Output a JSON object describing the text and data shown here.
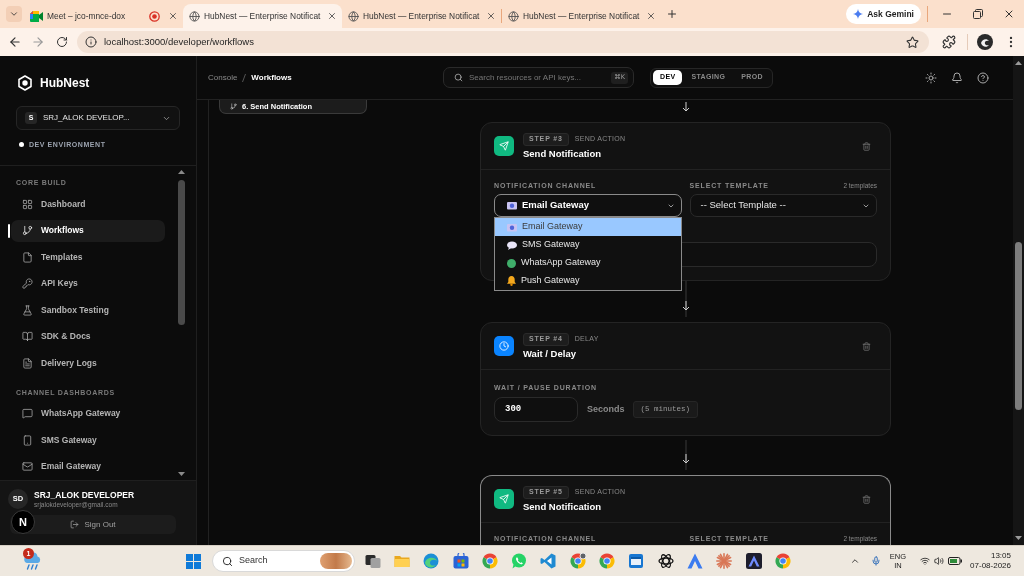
{
  "browser": {
    "tabs": [
      {
        "kind": "meet",
        "title": "Meet – jco-mnce-dox",
        "recording": true,
        "selected": false
      },
      {
        "kind": "page",
        "title": "HubNest — Enterprise Notificat",
        "recording": false,
        "selected": true
      },
      {
        "kind": "page",
        "title": "HubNest — Enterprise Notificat",
        "recording": false,
        "selected": false
      },
      {
        "kind": "page",
        "title": "HubNest — Enterprise Notificat",
        "recording": false,
        "selected": false
      }
    ],
    "assistant_button": "Ask Gemini",
    "url": "localhost:3000/developer/workflows"
  },
  "sidebar": {
    "brand": "HubNest",
    "workspace": {
      "initial": "S",
      "name": "SRJ_ALOK DEVELOP..."
    },
    "environment": "DEV ENVIRONMENT",
    "sections": [
      {
        "heading": "CORE BUILD",
        "items": [
          {
            "kind": "dashboard",
            "label": "Dashboard",
            "selected": false
          },
          {
            "kind": "workflows",
            "label": "Workflows",
            "selected": true
          },
          {
            "kind": "templates",
            "label": "Templates",
            "selected": false
          },
          {
            "kind": "api_keys",
            "label": "API Keys",
            "selected": false
          },
          {
            "kind": "sandbox",
            "label": "Sandbox Testing",
            "selected": false
          },
          {
            "kind": "docs",
            "label": "SDK & Docs",
            "selected": false
          },
          {
            "kind": "logs",
            "label": "Delivery Logs",
            "selected": false
          }
        ]
      },
      {
        "heading": "CHANNEL DASHBOARDS",
        "items": [
          {
            "kind": "whatsapp",
            "label": "WhatsApp Gateway",
            "selected": false
          },
          {
            "kind": "sms",
            "label": "SMS Gateway",
            "selected": false
          },
          {
            "kind": "email",
            "label": "Email Gateway",
            "selected": false
          }
        ]
      }
    ],
    "user": {
      "initials": "SD",
      "name": "SRJ_ALOK DEVELOPER",
      "email": "srjalokdeveloper@gmail.com"
    },
    "sign_out": "Sign Out",
    "dev_indicator": "N"
  },
  "header": {
    "breadcrumb": [
      {
        "label": "Console",
        "current": false
      },
      {
        "label": "Workflows",
        "current": true
      }
    ],
    "search": {
      "placeholder": "Search resources or API keys...",
      "shortcut": "⌘K"
    },
    "environments": [
      {
        "label": "DEV",
        "selected": true
      },
      {
        "label": "STAGING",
        "selected": false
      },
      {
        "label": "PROD",
        "selected": false
      }
    ]
  },
  "workflow": {
    "outline_item": "6. Send Notification",
    "steps": [
      {
        "kind": "send",
        "badge": "STEP #3",
        "category": "SEND ACTION",
        "title": "Send Notification",
        "selected": false,
        "channel_label": "NOTIFICATION CHANNEL",
        "template_label": "SELECT TEMPLATE",
        "template_count": "2 templates",
        "channel": {
          "kind": "email",
          "value": "Email Gateway",
          "open": true,
          "options": [
            {
              "kind": "email",
              "label": "Email Gateway",
              "selected": true
            },
            {
              "kind": "sms",
              "label": "SMS Gateway",
              "selected": false
            },
            {
              "kind": "whatsapp",
              "label": "WhatsApp Gateway",
              "selected": false
            },
            {
              "kind": "push",
              "label": "Push Gateway",
              "selected": false
            }
          ]
        },
        "template": "-- Select Template --"
      },
      {
        "kind": "delay",
        "badge": "STEP #4",
        "category": "DELAY",
        "title": "Wait / Delay",
        "selected": false,
        "duration_label": "WAIT / PAUSE DURATION",
        "duration": "300",
        "unit": "Seconds",
        "hint": "(5 minutes)"
      },
      {
        "kind": "send",
        "badge": "STEP #5",
        "category": "SEND ACTION",
        "title": "Send Notification",
        "selected": true,
        "channel_label": "NOTIFICATION CHANNEL",
        "template_label": "SELECT TEMPLATE",
        "template_count": "2 templates"
      }
    ]
  },
  "taskbar": {
    "weather_badge": "1",
    "search_placeholder": "Search",
    "language": "ENG",
    "region": "IN",
    "time": "13:05",
    "date": "07-08-2026"
  }
}
